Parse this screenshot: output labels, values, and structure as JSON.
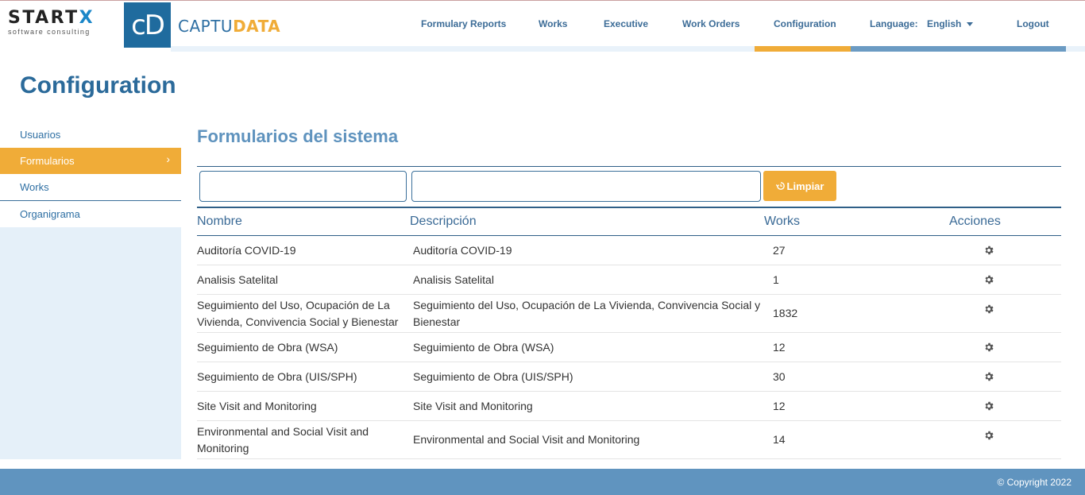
{
  "brand": {
    "startx_word": "START",
    "startx_x": "X",
    "startx_tagline": "software consulting",
    "cd_mark": "cD",
    "captu": "CAPTU",
    "data": "DATA"
  },
  "nav": {
    "items": [
      {
        "label": "Formulary Reports"
      },
      {
        "label": "Works"
      },
      {
        "label": "Executive"
      },
      {
        "label": "Work Orders"
      },
      {
        "label": "Configuration"
      }
    ],
    "language_label": "Language:",
    "language_value": "English",
    "logout": "Logout"
  },
  "page_title": "Configuration",
  "sidebar": {
    "items": [
      {
        "label": "Usuarios"
      },
      {
        "label": "Formularios",
        "chevron": "›"
      },
      {
        "label": "Works"
      },
      {
        "label": "Organigrama"
      }
    ]
  },
  "main": {
    "title": "Formularios del sistema",
    "filter_name_value": "",
    "filter_desc_value": "",
    "clear_label": "Limpiar",
    "columns": {
      "name": "Nombre",
      "description": "Descripción",
      "works": "Works",
      "actions": "Acciones"
    },
    "rows": [
      {
        "name": "Auditoría COVID-19",
        "description": "Auditoría COVID-19",
        "works": "27"
      },
      {
        "name": "Analisis Satelital",
        "description": "Analisis Satelital",
        "works": "1"
      },
      {
        "name": "Seguimiento del Uso, Ocupación de La Vivienda, Convivencia Social y Bienestar",
        "description": "Seguimiento del Uso, Ocupación de La Vivienda, Convivencia Social y Bienestar",
        "works": "1832"
      },
      {
        "name": "Seguimiento de Obra (WSA)",
        "description": "Seguimiento de Obra (WSA)",
        "works": "12"
      },
      {
        "name": "Seguimiento de Obra (UIS/SPH)",
        "description": "Seguimiento de Obra (UIS/SPH)",
        "works": "30"
      },
      {
        "name": "Site Visit and Monitoring",
        "description": "Site Visit and Monitoring",
        "works": "12"
      },
      {
        "name": "Environmental and Social Visit and Monitoring",
        "description": "Environmental and Social Visit and Monitoring",
        "works": "14"
      }
    ]
  },
  "footer": {
    "copyright": "© Copyright 2022"
  },
  "colors": {
    "accent": "#f0ac38",
    "primary": "#2b6a9a",
    "footer": "#6094bf",
    "sidebar_bg": "#e5f0f9"
  }
}
